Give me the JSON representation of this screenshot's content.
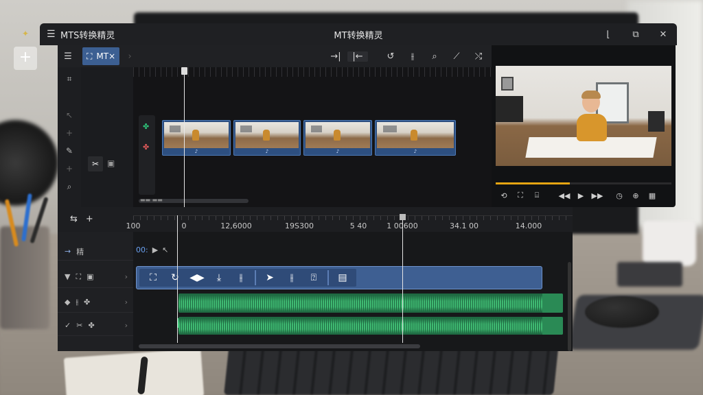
{
  "app": {
    "name": "MTS转换精灵",
    "window_title": "MT转换精灵",
    "window_buttons": [
      "minimize-icon",
      "restore-icon",
      "close-icon"
    ]
  },
  "desktop": {
    "add_button": "+"
  },
  "toolbar": {
    "tab_label": "MT×",
    "tools": [
      "split-in-icon",
      "split-out-icon",
      "undo-icon",
      "razor-icon",
      "zoom-icon",
      "magic-icon",
      "shuffle-icon"
    ]
  },
  "clips": [
    {
      "tag": "♪"
    },
    {
      "tag": "♪"
    },
    {
      "tag": "♪"
    },
    {
      "tag": "♪"
    }
  ],
  "media_scroll_label": "▬▬ ▬▬",
  "preview": {
    "progress": 0.42,
    "controls": [
      "loop-icon",
      "crop-icon",
      "subtitle-icon",
      "rewind-icon",
      "play-icon",
      "fast-forward-icon",
      "timer-icon",
      "target-icon",
      "grid-icon"
    ]
  },
  "timeline": {
    "ruler_labels": [
      "100",
      "0",
      "12,6000",
      "19S300",
      "5 40",
      "1 00600",
      "34.1 00",
      "14.000"
    ],
    "time_code": "00:",
    "track_name": "精",
    "audio_label": "♪",
    "colors": {
      "video_bar": "#3e5f92",
      "audio": "#1f6a42",
      "accent": "#e6a512"
    }
  }
}
